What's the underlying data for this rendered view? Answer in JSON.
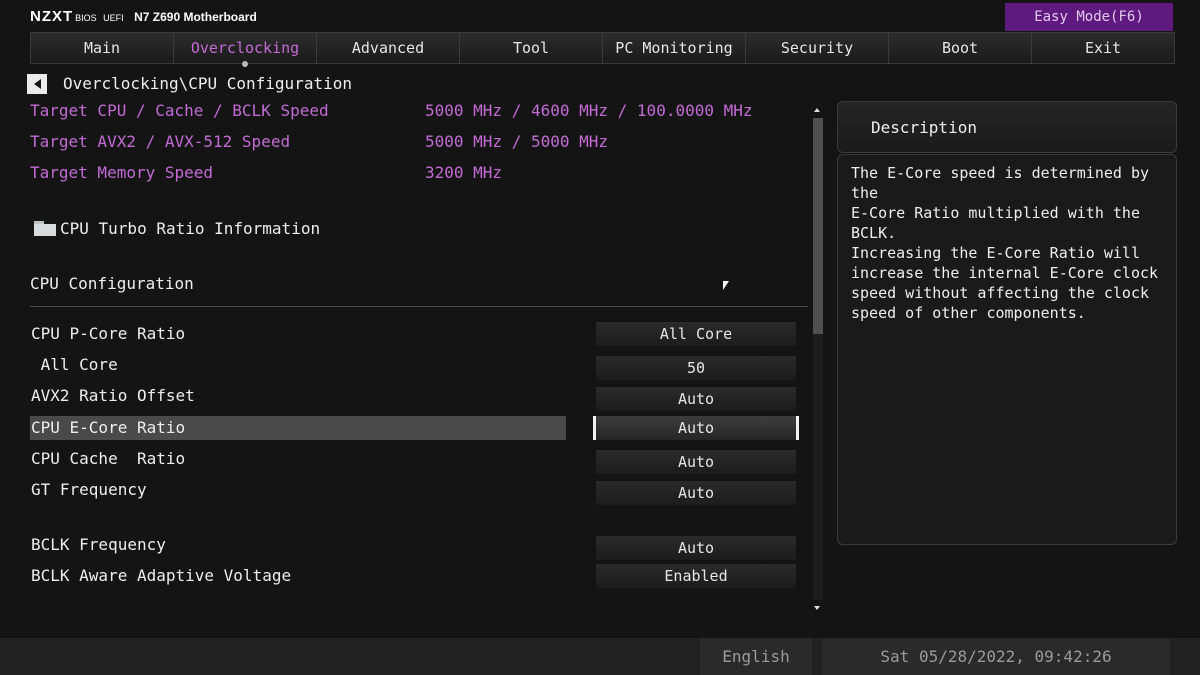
{
  "header": {
    "brand": "NZXT",
    "bios_label": "BIOS",
    "uefi_label": "UEFI",
    "model": "N7 Z690 Motherboard",
    "easy_mode": "Easy Mode(F6)"
  },
  "tabs": [
    {
      "label": "Main"
    },
    {
      "label": "Overclocking",
      "active": true
    },
    {
      "label": "Advanced"
    },
    {
      "label": "Tool"
    },
    {
      "label": "PC Monitoring"
    },
    {
      "label": "Security"
    },
    {
      "label": "Boot"
    },
    {
      "label": "Exit"
    }
  ],
  "breadcrumb": "Overclocking\\CPU Configuration",
  "info": [
    {
      "label": "Target CPU / Cache / BCLK Speed",
      "value": "5000 MHz / 4600 MHz / 100.0000 MHz"
    },
    {
      "label": "Target AVX2 / AVX-512 Speed",
      "value": "5000 MHz / 5000 MHz"
    },
    {
      "label": "Target Memory Speed",
      "value": "3200 MHz"
    }
  ],
  "submenu_label": "CPU Turbo Ratio Information",
  "section_title": "CPU Configuration",
  "settings": [
    {
      "label": "CPU P-Core Ratio",
      "value": "All Core"
    },
    {
      "label": " All Core",
      "value": "50"
    },
    {
      "label": "AVX2 Ratio Offset",
      "value": "Auto"
    },
    {
      "label": "CPU E-Core Ratio",
      "value": "Auto",
      "selected": true
    },
    {
      "label": "CPU Cache  Ratio",
      "value": "Auto"
    },
    {
      "label": "GT Frequency",
      "value": "Auto"
    },
    {
      "label": "BCLK Frequency",
      "value": "Auto"
    },
    {
      "label": "BCLK Aware Adaptive Voltage",
      "value": "Enabled"
    }
  ],
  "description": {
    "title": "Description",
    "text": "The E-Core speed is determined by the\nE-Core Ratio multiplied with the BCLK.\nIncreasing the E-Core Ratio will\nincrease the internal E-Core clock\nspeed without affecting the clock\nspeed of other components."
  },
  "footer": {
    "language": "English",
    "datetime": "Sat 05/28/2022, 09:42:26"
  },
  "colors": {
    "accent": "#c46ad6",
    "easy_mode_bg": "#5e1a7f",
    "background": "#141414"
  },
  "icons": {
    "back": "back-arrow-icon",
    "folder": "folder-icon",
    "cursor": "mouse-cursor-icon"
  }
}
